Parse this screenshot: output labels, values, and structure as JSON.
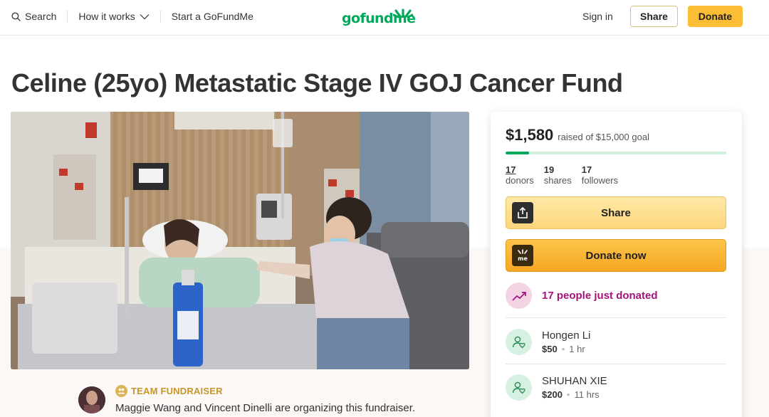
{
  "header": {
    "search_label": "Search",
    "how_it_works_label": "How it works",
    "start_label": "Start a GoFundMe",
    "logo_text": "gofundme",
    "signin_label": "Sign in",
    "share_label": "Share",
    "donate_label": "Donate",
    "brand_green": "#02a95c",
    "accent_yellow": "#fbbd33"
  },
  "campaign": {
    "title": "Celine (25yo) Metastatic Stage IV GOJ Cancer Fund",
    "team_label": "TEAM FUNDRAISER",
    "organizer_text": "Maggie Wang and Vincent Dinelli are organizing this fundraiser."
  },
  "donation": {
    "raised": "$1,580",
    "goal_text": "raised of $15,000 goal",
    "progress_fraction": 0.105,
    "stats": [
      {
        "value": "17",
        "label": "donors"
      },
      {
        "value": "19",
        "label": "shares"
      },
      {
        "value": "17",
        "label": "followers"
      }
    ],
    "share_button": "Share",
    "donate_button": "Donate now",
    "donate_icon_text": "me",
    "recent_text": "17 people just donated",
    "donors": [
      {
        "name": "Hongen Li",
        "amount": "$50",
        "time": "1 hr"
      },
      {
        "name": "SHUHAN XIE",
        "amount": "$200",
        "time": "11 hrs"
      }
    ]
  },
  "icons": {
    "search": "search-icon",
    "chevron": "chevron-down-icon",
    "share": "share-icon",
    "donate": "gofundme-icon",
    "trend": "trending-up-icon",
    "donor": "donor-heart-icon"
  }
}
